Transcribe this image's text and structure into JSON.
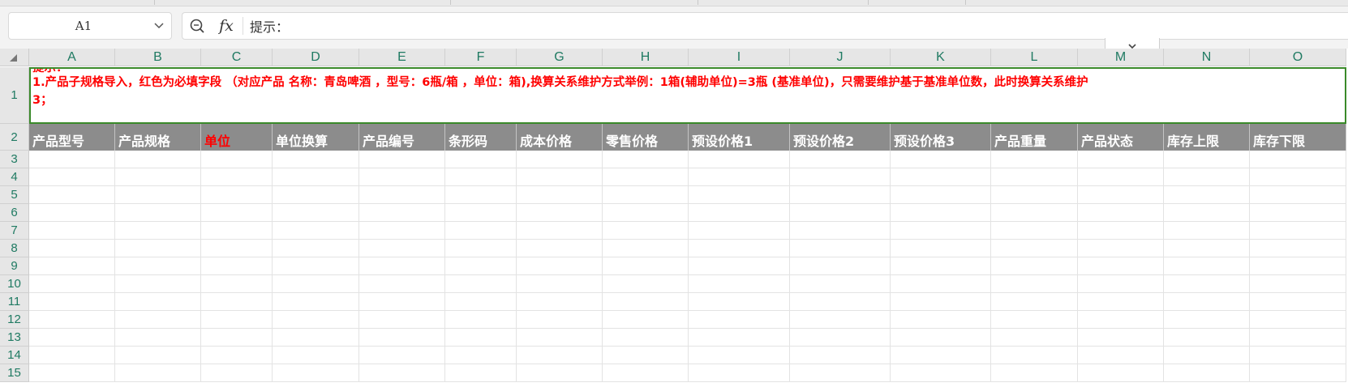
{
  "namebox": {
    "value": "A1"
  },
  "formula_bar": {
    "content": "提示：",
    "zoom_icon": "zoom-magnifier-icon",
    "fx_label": "fx"
  },
  "columns": [
    "A",
    "B",
    "C",
    "D",
    "E",
    "F",
    "G",
    "H",
    "I",
    "J",
    "K",
    "L",
    "M",
    "N",
    "O"
  ],
  "rows": [
    "1",
    "2",
    "3",
    "4",
    "5",
    "6",
    "7",
    "8",
    "9",
    "10",
    "11",
    "12",
    "13",
    "14",
    "15"
  ],
  "tip_cell": {
    "heading": "提示：",
    "line1": "1.产品子规格导入，红色为必填字段 （对应产品 名称：青岛啤酒 ，型号：6瓶/箱 ，单位：箱),换算关系维护方式举例：1箱(辅助单位)=3瓶 (基准单位)，只需要维护基于基准单位数，此时换算关系维护",
    "line2": "3；"
  },
  "header_row": [
    {
      "label": "产品型号",
      "required": false
    },
    {
      "label": "产品规格",
      "required": false
    },
    {
      "label": "单位",
      "required": true
    },
    {
      "label": "单位换算",
      "required": false
    },
    {
      "label": "产品编号",
      "required": false
    },
    {
      "label": "条形码",
      "required": false
    },
    {
      "label": "成本价格",
      "required": false
    },
    {
      "label": "零售价格",
      "required": false
    },
    {
      "label": "预设价格1",
      "required": false
    },
    {
      "label": "预设价格2",
      "required": false
    },
    {
      "label": "预设价格3",
      "required": false
    },
    {
      "label": "产品重量",
      "required": false
    },
    {
      "label": "产品状态",
      "required": false
    },
    {
      "label": "库存上限",
      "required": false
    },
    {
      "label": "库存下限",
      "required": false
    }
  ],
  "colors": {
    "selection": "#3a8a2a",
    "header_fill": "#8c8c8c",
    "required_text": "#ff0000",
    "axis_text": "#1f7a62"
  }
}
